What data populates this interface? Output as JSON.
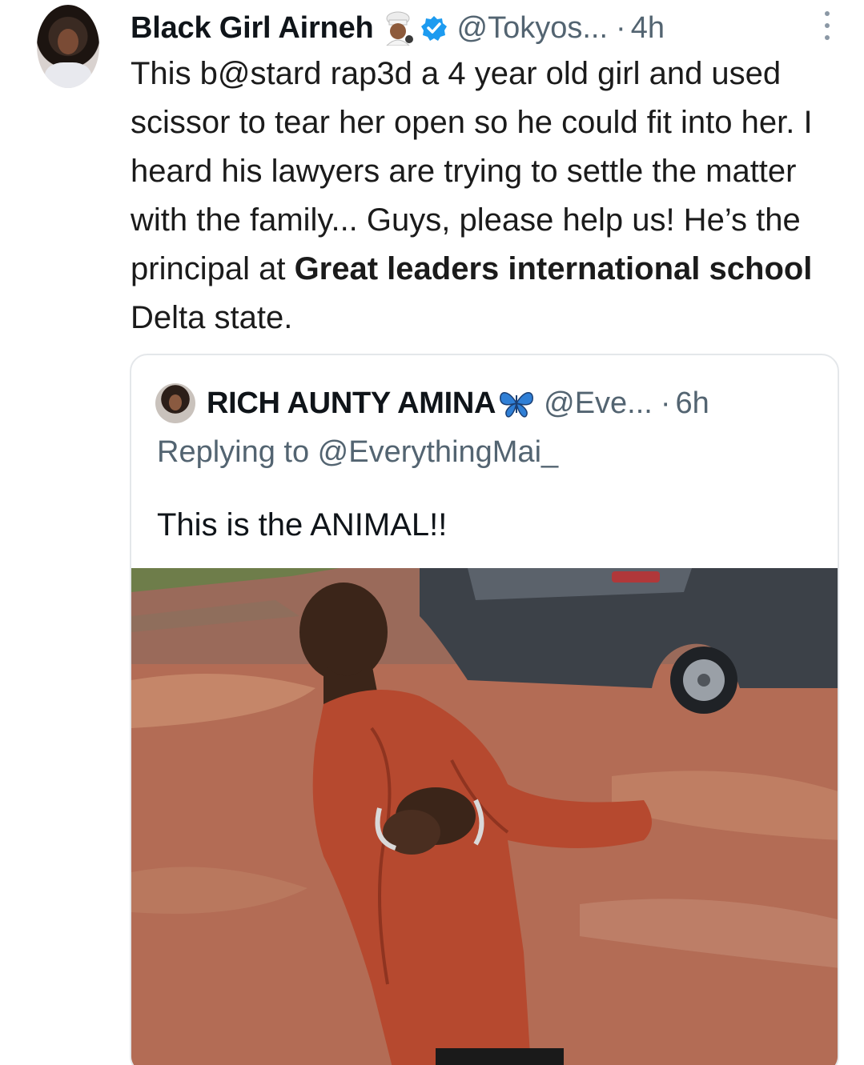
{
  "tweet": {
    "author_name": "Black Girl Airneh",
    "author_handle": "@Tokyos...",
    "separator": "·",
    "time": "4h",
    "author_emoji": "cook-emoji-icon",
    "verified": true,
    "text_part1": "This b@stard rap3d a 4 year old girl and used scissor to tear her open so he could fit into her. I heard his lawyers are trying to settle the matter with the family... Guys, please help us! He’s the principal at ",
    "text_bold": "Great leaders international school",
    "text_part2": " Delta state."
  },
  "quoted_tweet": {
    "author_name": "RICH AUNTY AMINA",
    "author_handle": "@Eve...",
    "separator": "·",
    "time": "6h",
    "name_emoji": "butterfly-icon",
    "replying_to": "Replying to @EverythingMai_",
    "text": "This is the ANIMAL!!",
    "media": "photo"
  },
  "colors": {
    "verified_blue": "#1d9bf0",
    "secondary_text": "#536471",
    "border": "#e4e7ea"
  }
}
